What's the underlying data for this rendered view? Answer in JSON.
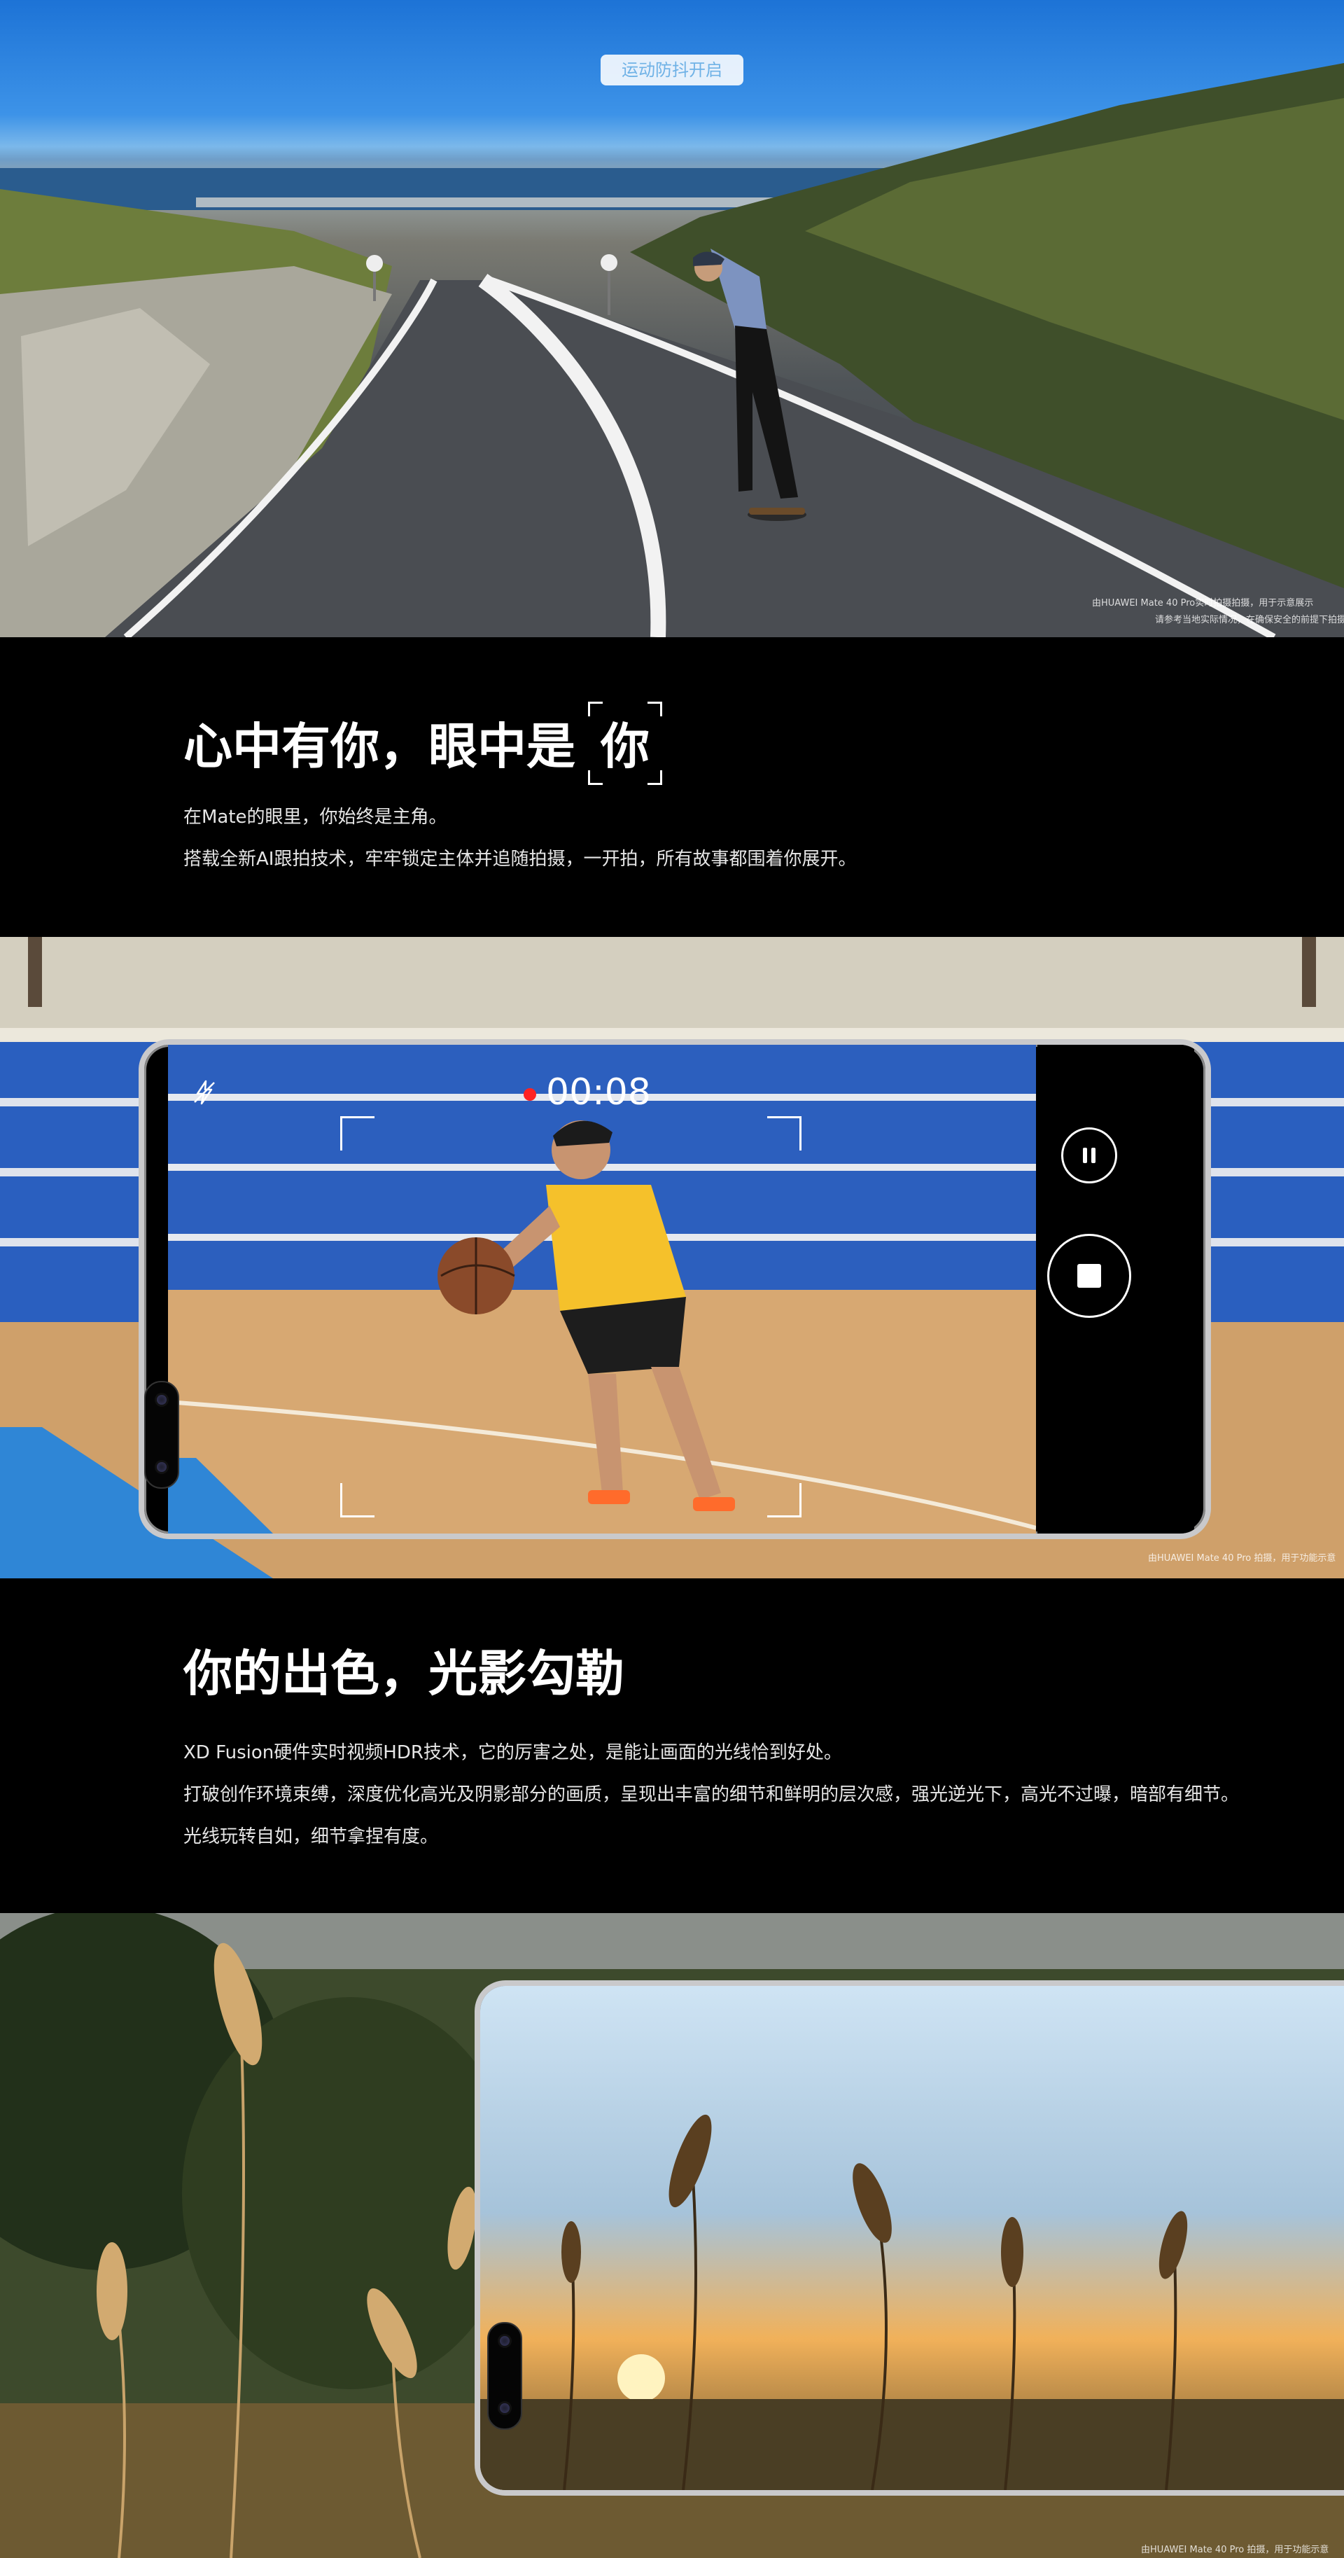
{
  "section1": {
    "badge_label": "运动防抖开启",
    "caption_line1": "由HUAWEI Mate 40 Pro实时拍摄拍摄，用于示意展示",
    "caption_line2": "请参考当地实际情况，在确保安全的前提下拍摄"
  },
  "text1": {
    "heading": "心中有你，眼中是",
    "heading_bracket_word": "你",
    "line1": "在Mate的眼里，你始终是主角。",
    "line2": "搭载全新AI跟拍技术，牢牢锁定主体并追随拍摄，一开拍，所有故事都围着你展开。"
  },
  "section2": {
    "record_timer": "00:08",
    "caption": "由HUAWEI Mate 40 Pro 拍摄，用于功能示意",
    "icons": {
      "flash_off": "flash-off-icon",
      "pause": "pause-icon",
      "stop": "stop-icon"
    }
  },
  "text2": {
    "heading": "你的出色，光影勾勒",
    "line1": "XD Fusion硬件实时视频HDR技术，它的厉害之处，是能让画面的光线恰到好处。",
    "line2": "打破创作环境束缚，深度优化高光及阴影部分的画质，呈现出丰富的细节和鲜明的层次感，强光逆光下，高光不过曝，暗部有细节。",
    "line3": "光线玩转自如，细节拿捏有度。"
  },
  "section3": {
    "caption": "由HUAWEI Mate 40 Pro 拍摄，用于功能示意"
  },
  "colors": {
    "background": "#000000",
    "badge_text": "#6fb2e6",
    "record_red": "#ff2222"
  }
}
